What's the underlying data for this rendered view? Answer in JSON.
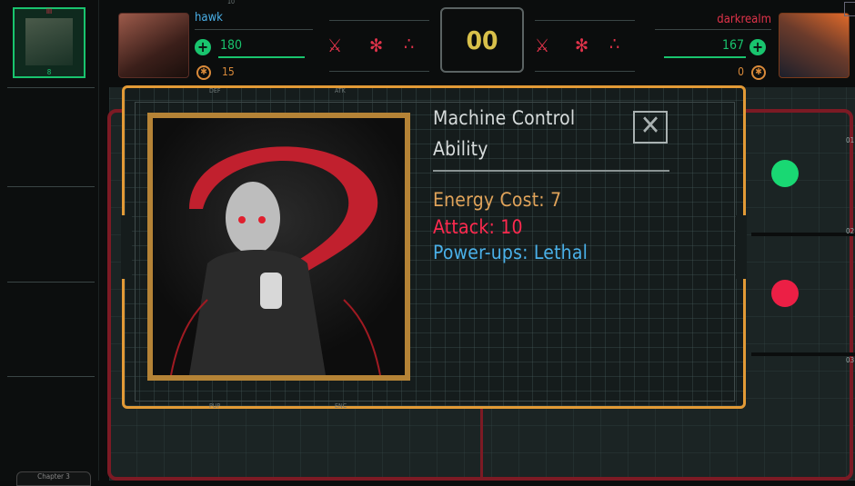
{
  "left_panel": {
    "avatar_top_label": "III",
    "avatar_bottom_label": "8",
    "bottom_tab_label": "Chapter 3"
  },
  "player1": {
    "name": "hawk",
    "hp": "180",
    "energy": "15",
    "hp_fraction": 0.95,
    "top_tick": "10"
  },
  "player2": {
    "name": "darkrealm",
    "hp": "167",
    "energy": "0",
    "hp_fraction": 0.9
  },
  "counter": {
    "value": "00"
  },
  "hud_icons": [
    "crossed-swords-icon",
    "spider-icon",
    "three-dots-icon"
  ],
  "board": {
    "row_labels": [
      "01",
      "02",
      "03"
    ],
    "colors": {
      "frame": "#7c1a24",
      "player_token": "#19d873",
      "enemy_token": "#ec1f45"
    }
  },
  "modal": {
    "title": "Machine Control",
    "subtitle": "Ability",
    "energy_cost": "Energy Cost: 7",
    "attack": "Attack: 10",
    "powerups": "Power-ups: Lethal",
    "frame_labels": [
      "DEF",
      "ATK",
      "PUP",
      "ENC"
    ],
    "close_icon": "close-x-icon",
    "colors": {
      "frame": "#e29a36",
      "energy": "#e0a35a",
      "attack": "#ff2a4f",
      "powerups": "#4ab0e8"
    }
  }
}
